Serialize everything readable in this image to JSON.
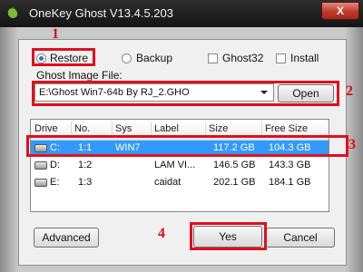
{
  "window": {
    "title": "OneKey Ghost V13.4.5.203",
    "close_glyph": "X"
  },
  "modes": {
    "restore_label": "Restore",
    "backup_label": "Backup",
    "selected": "Restore",
    "ghost32_label": "Ghost32",
    "install_label": "Install"
  },
  "image_file": {
    "label": "Ghost Image File:",
    "value": "E:\\Ghost Win7-64b By RJ_2.GHO",
    "open_label": "Open"
  },
  "partitions": {
    "columns": [
      "Drive",
      "No.",
      "Sys",
      "Label",
      "Size",
      "Free Size"
    ],
    "rows": [
      {
        "drive": "C:",
        "no": "1:1",
        "sys": "WIN7",
        "label": "",
        "size": "117.2 GB",
        "free": "104.3 GB",
        "selected": true
      },
      {
        "drive": "D:",
        "no": "1:2",
        "sys": "",
        "label": "LAM VI...",
        "size": "146.5 GB",
        "free": "143.3 GB",
        "selected": false
      },
      {
        "drive": "E:",
        "no": "1:3",
        "sys": "",
        "label": "caidat",
        "size": "202.1 GB",
        "free": "184.1 GB",
        "selected": false
      }
    ]
  },
  "buttons": {
    "advanced": "Advanced",
    "yes": "Yes",
    "cancel": "Cancel"
  },
  "annotations": {
    "n1": "1",
    "n2": "2",
    "n3": "3",
    "n4": "4"
  },
  "colors": {
    "annotation": "#e0101c",
    "selection": "#3399ff"
  },
  "icons": {
    "app": "onekey-ghost-icon",
    "drive": "hard-drive-icon"
  }
}
